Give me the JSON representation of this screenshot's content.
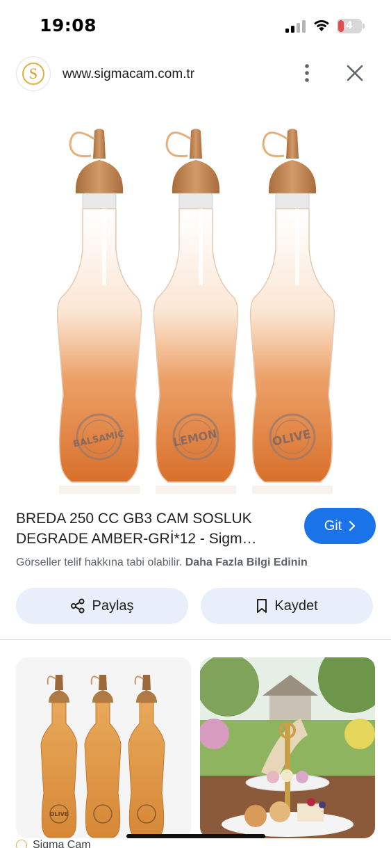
{
  "status_bar": {
    "time": "19:08",
    "battery_level": "4",
    "icons": [
      "signal-icon",
      "wifi-icon",
      "battery-icon"
    ]
  },
  "browser": {
    "url": "www.sigmacam.com.tr",
    "logo_letter": "S",
    "icons": [
      "more-vertical-icon",
      "close-icon"
    ]
  },
  "product_image": {
    "bottle_labels": [
      "BALSAMIC",
      "LEMON",
      "OLIVE"
    ],
    "accent_colors": {
      "amber": "#d9813f",
      "cap": "#b97f4d"
    }
  },
  "result": {
    "title_line1": "BREDA 250 CC GB3 CAM SOSLUK",
    "title_line2": "DEGRADE AMBER-GRİ*12 - Sigm…",
    "go_label": "Git",
    "copyright_text": "Görseller telif hakkına tabi olabilir.",
    "learn_more_label": "Daha Fazla Bilgi Edinin",
    "share_label": "Paylaş",
    "save_label": "Kaydet"
  },
  "related": {
    "thumb_1_label": "OLIVE",
    "source_label": "Sigma Cam"
  },
  "colors": {
    "primary_button": "#1a73e8",
    "secondary_button_bg": "#e8effb",
    "text": "#1f1f1f",
    "muted_text": "#5f6368"
  }
}
